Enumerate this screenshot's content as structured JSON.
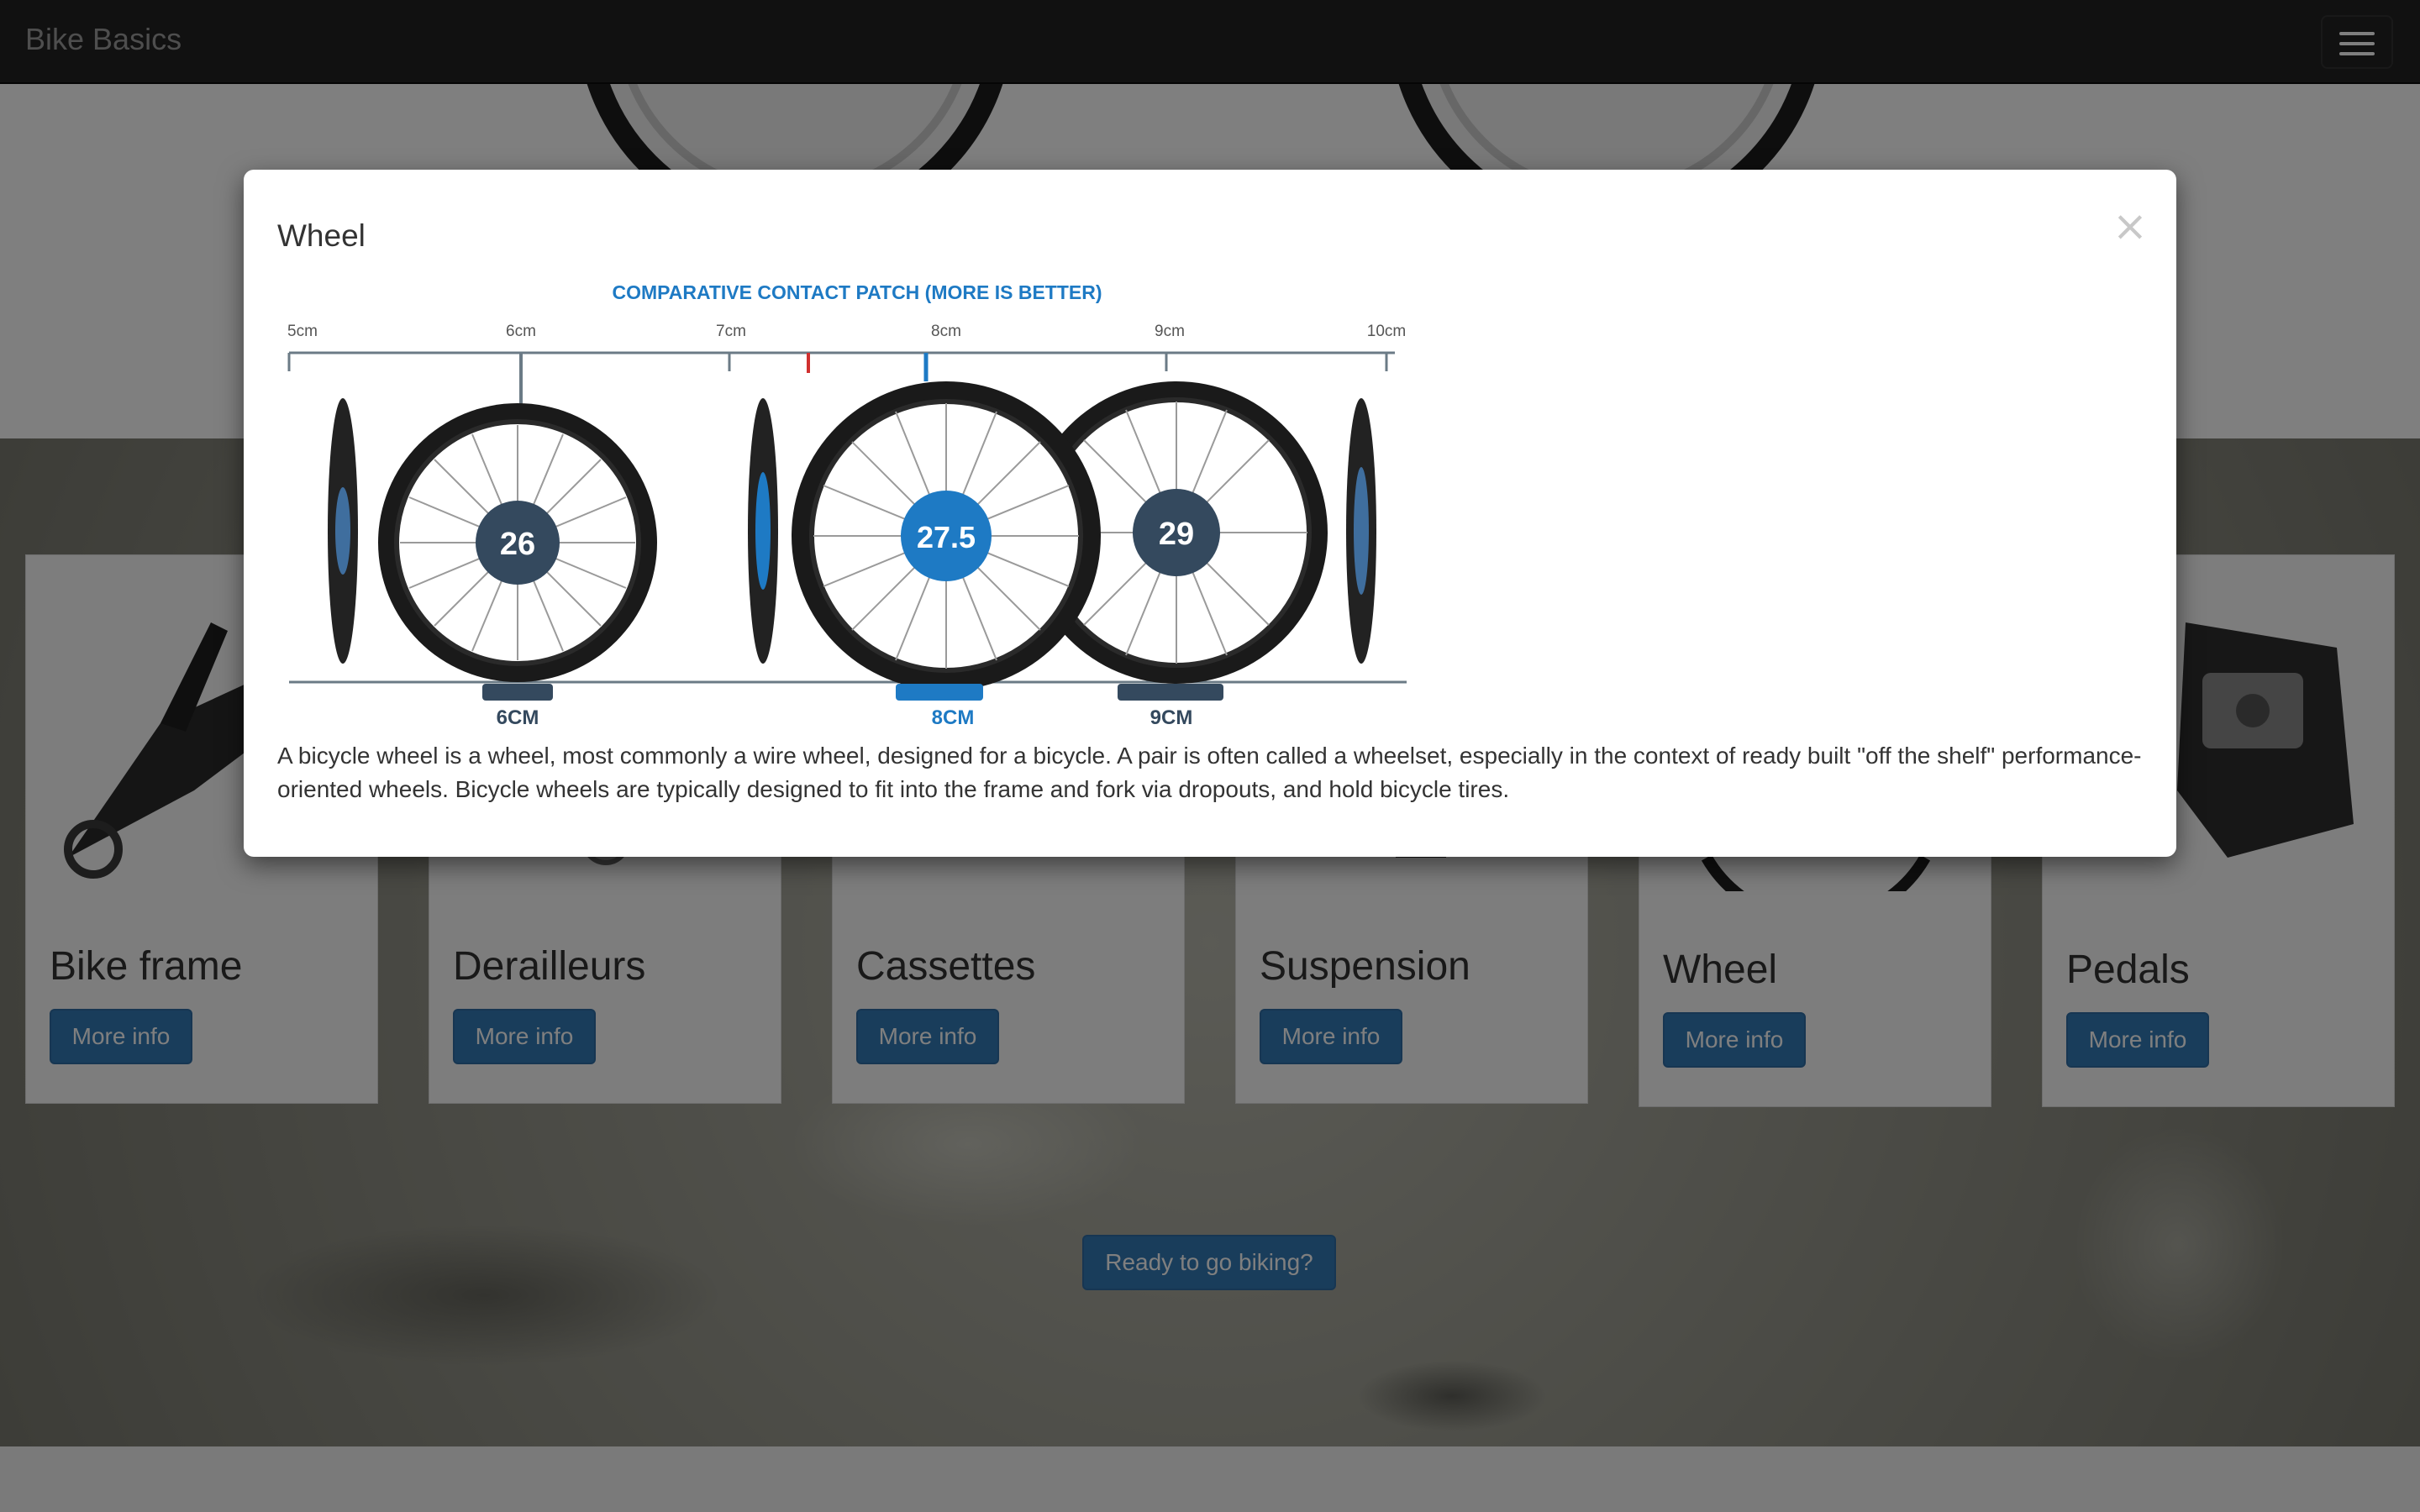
{
  "navbar": {
    "brand": "Bike Basics",
    "menu_icon": "hamburger-menu-icon"
  },
  "cards": [
    {
      "title": "Bike frame",
      "button": "More info",
      "icon": "bike-frame-icon"
    },
    {
      "title": "Derailleurs",
      "button": "More info",
      "icon": "derailleur-icon"
    },
    {
      "title": "Cassettes",
      "button": "More info",
      "icon": "cassette-icon"
    },
    {
      "title": "Suspension",
      "button": "More info",
      "icon": "suspension-icon"
    },
    {
      "title": "Wheel",
      "button": "More info",
      "icon": "wheel-icon"
    },
    {
      "title": "Pedals",
      "button": "More info",
      "icon": "pedal-icon"
    }
  ],
  "cta": {
    "label": "Ready to go biking?"
  },
  "modal": {
    "title": "Wheel",
    "close_glyph": "×",
    "figure": {
      "heading": "COMPARATIVE CONTACT PATCH (MORE IS BETTER)",
      "scale_labels": [
        "5cm",
        "6cm",
        "7cm",
        "8cm",
        "9cm",
        "10cm"
      ],
      "wheels": [
        {
          "size": "26",
          "patch": "6CM"
        },
        {
          "size": "27.5",
          "patch": "8CM"
        },
        {
          "size": "29",
          "patch": "9CM"
        }
      ]
    },
    "body": "A bicycle wheel is a wheel, most commonly a wire wheel, designed for a bicycle. A pair is often called a wheelset, especially in the context of ready built \"off the shelf\" performance-oriented wheels. Bicycle wheels are typically designed to fit into the frame and fork via dropouts, and hold bicycle tires."
  },
  "colors": {
    "navbar_bg": "#222222",
    "brand_text": "#9d9d9d",
    "primary_button": "#337ab7",
    "figure_blue": "#1e7ac4",
    "figure_navy": "#34495e"
  }
}
